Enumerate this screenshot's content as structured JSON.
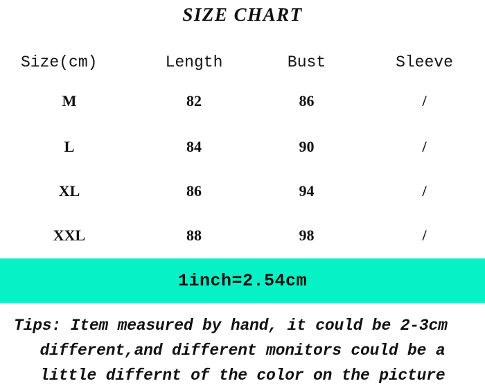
{
  "title": "SIZE CHART",
  "table": {
    "headers": [
      "Size(cm)",
      "Length",
      "Bust",
      "Sleeve"
    ],
    "rows": [
      {
        "size": "M",
        "length": "82",
        "bust": "86",
        "sleeve": "/"
      },
      {
        "size": "L",
        "length": "84",
        "bust": "90",
        "sleeve": "/"
      },
      {
        "size": "XL",
        "length": "86",
        "bust": "94",
        "sleeve": "/"
      },
      {
        "size": "XXL",
        "length": "88",
        "bust": "98",
        "sleeve": "/"
      }
    ]
  },
  "conversion": {
    "text": "1inch=2.54cm",
    "background_color": "#06f2c6"
  },
  "tips": {
    "line1": "Tips: Item measured by hand, it could be 2-3cm",
    "line2": "different,and different monitors could be a",
    "line3": "little differnt of the color on the picture"
  },
  "colors": {
    "background": "#ffffff",
    "text": "#111111",
    "accent": "#06f2c6"
  }
}
